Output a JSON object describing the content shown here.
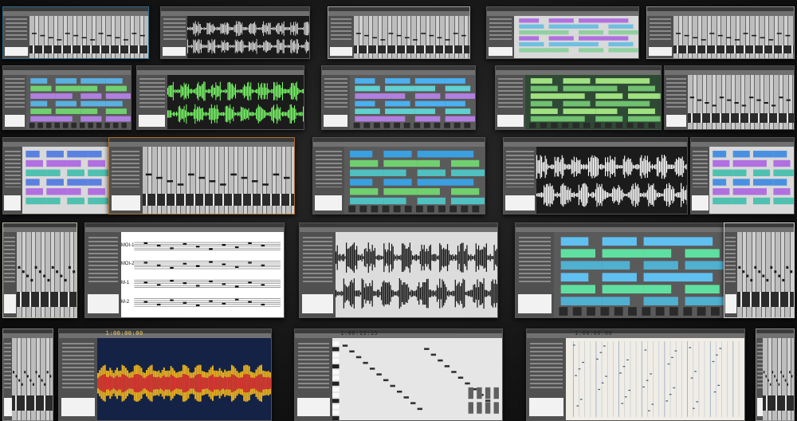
{
  "wall": {
    "background": "#111111",
    "tiles": [
      {
        "row": 0,
        "col": 0,
        "view": "mixer",
        "accent": "#2a6a8a"
      },
      {
        "row": 0,
        "col": 1,
        "view": "wave",
        "wave_color": "#e0e0e0"
      },
      {
        "row": 0,
        "col": 2,
        "view": "mixer",
        "accent": "#a0a0a0"
      },
      {
        "row": 0,
        "col": 3,
        "view": "tracks",
        "lanes": [
          "#b070e0",
          "#70c0e0",
          "#90d0a0"
        ]
      },
      {
        "row": 0,
        "col": 4,
        "view": "mixer",
        "accent": "#8a8a8a"
      },
      {
        "row": 1,
        "col": 0,
        "view": "clips",
        "lanes": [
          "#5ab0e0",
          "#70d070",
          "#b080e0"
        ]
      },
      {
        "row": 1,
        "col": 1,
        "view": "wave",
        "wave_color": "#7cff6a"
      },
      {
        "row": 1,
        "col": 2,
        "view": "clips",
        "lanes": [
          "#4ab0f0",
          "#60d0d0",
          "#b080e0"
        ]
      },
      {
        "row": 1,
        "col": 3,
        "view": "panel",
        "lanes": [
          "#a0e080",
          "#70c070"
        ]
      },
      {
        "row": 1,
        "col": 4,
        "view": "mixer",
        "accent": "#4a4a4a"
      },
      {
        "row": 2,
        "col": 0,
        "view": "tracks",
        "lanes": [
          "#5a80e0",
          "#b070e0",
          "#50c0b0"
        ]
      },
      {
        "row": 2,
        "col": 1,
        "view": "mixer",
        "accent": "#b07030"
      },
      {
        "row": 2,
        "col": 2,
        "view": "clips",
        "lanes": [
          "#3aa0e0",
          "#70d070",
          "#50c0c0"
        ]
      },
      {
        "row": 2,
        "col": 3,
        "view": "wave",
        "wave_color": "#ffffff"
      },
      {
        "row": 2,
        "col": 4,
        "view": "tracks",
        "lanes": [
          "#4a90e0",
          "#b070e0",
          "#50c0b0"
        ]
      },
      {
        "row": 3,
        "col": 0,
        "view": "mixer",
        "accent": "#b8b8a8"
      },
      {
        "row": 3,
        "col": 1,
        "view": "score",
        "staves": [
          "MOI-1",
          "MOI-2",
          "M-1",
          "M-2"
        ]
      },
      {
        "row": 3,
        "col": 2,
        "view": "wave_light",
        "wave_color": "#111111"
      },
      {
        "row": 3,
        "col": 3,
        "view": "clips",
        "lanes": [
          "#60c0f0",
          "#60e0a0",
          "#50b0d0"
        ]
      },
      {
        "row": 3,
        "col": 4,
        "view": "mixer",
        "accent": "#d0d0d0"
      },
      {
        "row": 4,
        "col": 0,
        "view": "mixer",
        "accent": "#808080"
      },
      {
        "row": 4,
        "col": 1,
        "view": "spectro",
        "timecode": "1:00:00:00"
      },
      {
        "row": 4,
        "col": 2,
        "view": "piano",
        "timecode": "1:00:13:15"
      },
      {
        "row": 4,
        "col": 3,
        "view": "grid",
        "timecode": "1:00:00:00"
      },
      {
        "row": 4,
        "col": 4,
        "view": "mixer",
        "accent": "#909090"
      }
    ]
  }
}
